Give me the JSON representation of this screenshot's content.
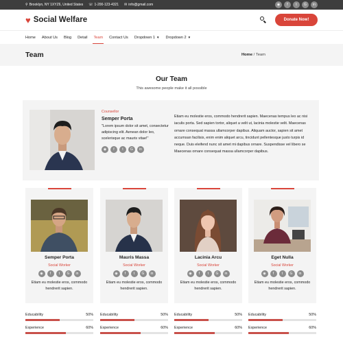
{
  "topbar": {
    "address": "Brooklyn, NY 1XYZ6, United States",
    "phone": "1-200-123-4321",
    "email": "info@gmail.com",
    "social": [
      "rss-icon",
      "facebook-icon",
      "twitter-icon",
      "google-plus-icon",
      "linkedin-icon"
    ]
  },
  "brand": {
    "name": "Social Welfare"
  },
  "header": {
    "donate_label": "Donate Now!"
  },
  "nav": {
    "items": [
      {
        "label": "Home"
      },
      {
        "label": "About Us"
      },
      {
        "label": "Blog"
      },
      {
        "label": "Detail"
      },
      {
        "label": "Team",
        "active": true
      },
      {
        "label": "Contact Us"
      },
      {
        "label": "Dropdown 1"
      },
      {
        "label": "Dropdown 2"
      }
    ]
  },
  "banner": {
    "title": "Team",
    "crumb_home": "Home",
    "crumb_sep": "/",
    "crumb_current": "Team"
  },
  "section": {
    "title": "Our Team",
    "subtitle": "This awesome people make it all possible"
  },
  "featured": {
    "role": "Counsellor",
    "name": "Semper Porta",
    "quote": "\"Lorem ipsum dolor sit amet, consectetur adipiscing elit. Aenean dolor leo, scelerisque ac mauris vitae!\"",
    "bio": "Etiam eu molestie eros, commodo hendrerit sapien. Maecenas tempus leo ac nisi iaculis porta. Sed sapien tortor, aliquet a velit ut, lacinia molestie velit. Maecenas ornare consequat massa ullamcorper dapibus. Aliquam auctor, sapien sit amet accumsan facilisis, enim enim aliquet arcu, tincidunt pellentesque justo turpis id neque. Duis eleifend nunc sit amet mi dapibus ornare. Suspendisse vel libero se Maecenas ornare consequat massa ullamcorper dapibus."
  },
  "team": [
    {
      "name": "Semper Porta",
      "role": "Social Worker",
      "desc": "Etiam eu molestie eros, commodo hendrerit sapien.",
      "skills": [
        {
          "label": "Educability",
          "value": "50%",
          "pct": 50
        },
        {
          "label": "Experience",
          "value": "60%",
          "pct": 60
        }
      ]
    },
    {
      "name": "Mauris Massa",
      "role": "Social Worker",
      "desc": "Etiam eu molestie eros, commodo hendrerit sapien.",
      "skills": [
        {
          "label": "Educability",
          "value": "50%",
          "pct": 50
        },
        {
          "label": "Experience",
          "value": "60%",
          "pct": 60
        }
      ]
    },
    {
      "name": "Lacinia Arcu",
      "role": "Social Worker",
      "desc": "Etiam eu molestie eros, commodo hendrerit sapien.",
      "skills": [
        {
          "label": "Educability",
          "value": "50%",
          "pct": 50
        },
        {
          "label": "Experience",
          "value": "60%",
          "pct": 60
        }
      ]
    },
    {
      "name": "Eget Nulla",
      "role": "Social Worker",
      "desc": "Etiam eu molestie eros, commodo hendrerit sapien.",
      "skills": [
        {
          "label": "Educability",
          "value": "50%",
          "pct": 50
        },
        {
          "label": "Experience",
          "value": "60%",
          "pct": 60
        }
      ]
    }
  ],
  "colors": {
    "accent": "#d9453a",
    "topbar": "#3d3d3d",
    "panel": "#f4f4f4",
    "icon_grey": "#8c8c8c"
  }
}
